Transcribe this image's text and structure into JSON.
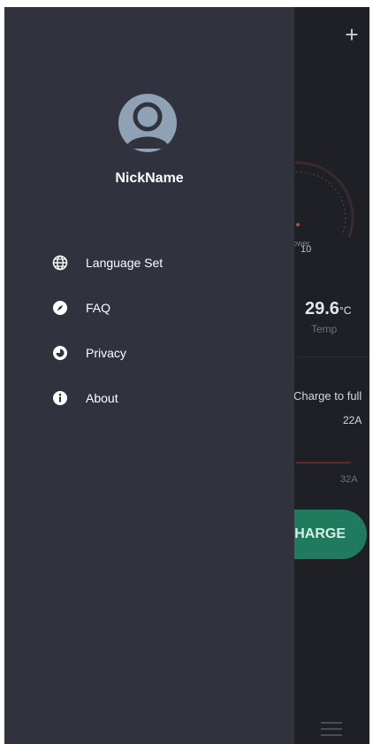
{
  "background_app": {
    "plus_icon": "plus-icon",
    "gauge_max": "10",
    "gauge_label": "ower",
    "temp_value": "29.6",
    "temp_unit": "°C",
    "temp_label": "Temp",
    "charge_to_full_label": "Charge to full",
    "current_value_1": "22A",
    "current_value_2": "32A",
    "charge_button_label": "HARGE",
    "accent_color": "#1f7a5e"
  },
  "drawer": {
    "nickname": "NickName",
    "items": [
      {
        "icon": "globe-icon",
        "label": "Language Set"
      },
      {
        "icon": "compass-icon",
        "label": "FAQ"
      },
      {
        "icon": "privacy-icon",
        "label": "Privacy"
      },
      {
        "icon": "info-icon",
        "label": "About"
      }
    ]
  }
}
